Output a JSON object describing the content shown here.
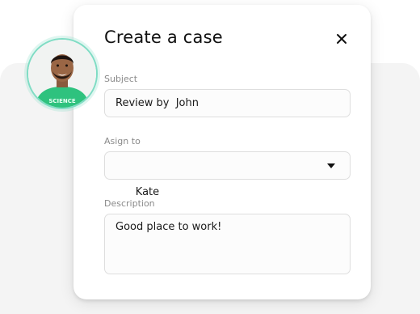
{
  "dialog": {
    "title": "Create a case",
    "close_icon": "close-icon"
  },
  "subject": {
    "label": "Subject",
    "value": "Review by  John"
  },
  "assign": {
    "label": "Asign to",
    "value": "Kate",
    "icon": "chevron-down-icon"
  },
  "description": {
    "label": "Description",
    "value": "Good place to work!"
  },
  "avatar": {
    "ring_color": "#7fdcc4",
    "shirt_color": "#2ec27e",
    "shirt_text": "SCIENCE"
  }
}
